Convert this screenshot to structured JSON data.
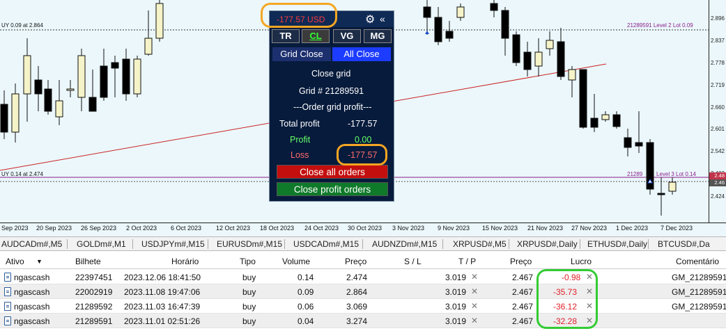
{
  "colors": {
    "chart_bg": "#ebf7fb",
    "bull_fill": "#f5f3c8",
    "bear_fill": "#000000",
    "trendline": "#cc2222",
    "panel_bg": "#071b3c",
    "loss_red": "#ff3b3b",
    "profit_green": "#66ff66",
    "annot_orange": "#f5a623",
    "annot_green": "#33cc33"
  },
  "chart": {
    "price_ticks": [
      "2.896",
      "2.837",
      "2.778",
      "2.719",
      "2.660",
      "2.601",
      "2.542",
      "2.483",
      "2.424"
    ],
    "current_price_tags": [
      "2.48",
      "2.46"
    ],
    "time_labels": [
      "Sep 2023",
      "20 Sep 2023",
      "26 Sep 2023",
      "2 Oct 2023",
      "6 Oct 2023",
      "12 Oct 2023",
      "18 Oct 2023",
      "24 Oct 2023",
      "30 Oct 2023",
      "3 Nov 2023",
      "9 Nov 2023",
      "15 Nov 2023",
      "21 Nov 2023",
      "27 Nov 2023",
      "1 Dec 2023",
      "7 Dec 2023"
    ],
    "lines": {
      "left_top": "UY 0.09 at 2.864",
      "left_bottom": "UY 0.14 at 2.474",
      "right_top": "21289591 Level 2 Lot 0.09",
      "right_bottom_id": "21289",
      "right_bottom_level": "Level 3 Lot 0.14"
    }
  },
  "panel": {
    "usd": "-177.57 USD",
    "gear_icon": "gear-icon",
    "collapse_icon": "double-chevron-left-icon",
    "tabs": [
      "TR",
      "CL",
      "VG",
      "MG"
    ],
    "active_tab": "CL",
    "grid_close": "Grid Close",
    "all_close": "All Close",
    "close_grid": "Close grid",
    "grid_num": "Grid # 21289591",
    "order_profit": "---Order grid profit---",
    "total_profit_label": "Total profit",
    "total_profit_value": "-177.57",
    "profit_label": "Profit",
    "profit_value": "0.00",
    "loss_label": "Loss",
    "loss_value": "-177.57",
    "close_all": "Close all orders",
    "close_profit": "Close profit orders"
  },
  "symbol_tabs": [
    "AUDCADm#,M5",
    "GOLDm#,M1",
    "USDJPYm#,M15",
    "EURUSDm#,M15",
    "USDCADm#,M15",
    "AUDNZDm#,M15",
    "XRPUSD#,M5",
    "XRPUSD#,Daily",
    "ETHUSD#,Daily",
    "BTCUSD#,Da"
  ],
  "table": {
    "headers": {
      "ativo": "Ativo",
      "bilhete": "Bilhete",
      "horario": "Horário",
      "tipo": "Tipo",
      "volume": "Volume",
      "preco": "Preço",
      "sl": "S / L",
      "tp": "T / P",
      "preco2": "Preço",
      "lucro": "Lucro",
      "comentario": "Comentário"
    },
    "rows": [
      {
        "ativo": "ngascash",
        "bilhete": "22397451",
        "horario": "2023.12.06 18:41:50",
        "tipo": "buy",
        "volume": "0.14",
        "preco": "2.474",
        "tp": "3.019",
        "preco2": "2.467",
        "lucro": "-0.98",
        "comentario": "GM_21289591"
      },
      {
        "ativo": "ngascash",
        "bilhete": "22002919",
        "horario": "2023.11.08 19:47:06",
        "tipo": "buy",
        "volume": "0.09",
        "preco": "2.864",
        "tp": "3.019",
        "preco2": "2.467",
        "lucro": "-35.73",
        "comentario": "GM_21289591"
      },
      {
        "ativo": "ngascash",
        "bilhete": "21289592",
        "horario": "2023.11.03 16:47:39",
        "tipo": "buy",
        "volume": "0.06",
        "preco": "3.069",
        "tp": "3.019",
        "preco2": "2.467",
        "lucro": "-36.12",
        "comentario": "GM_21289591"
      },
      {
        "ativo": "ngascash",
        "bilhete": "21289591",
        "horario": "2023.11.01 02:51:26",
        "tipo": "buy",
        "volume": "0.04",
        "preco": "3.274",
        "tp": "3.019",
        "preco2": "2.467",
        "lucro": "-32.28",
        "comentario": ""
      }
    ]
  }
}
